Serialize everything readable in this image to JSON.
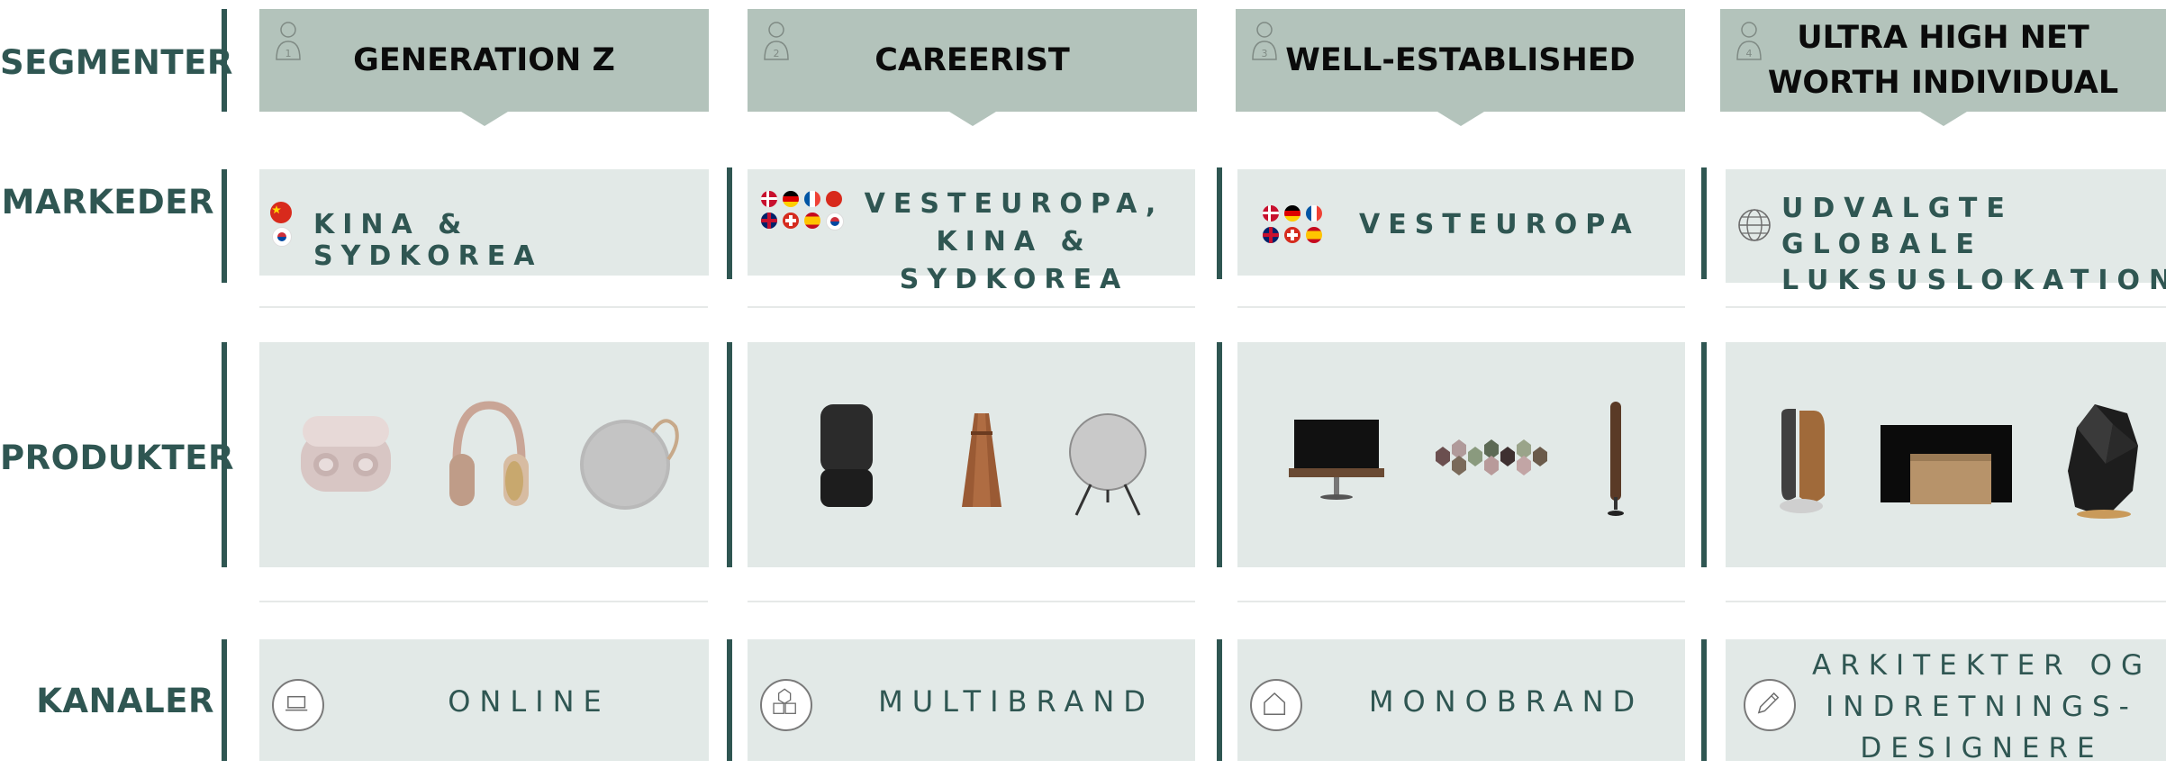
{
  "row_labels": {
    "segments": "SEGMENTER",
    "markets": "MARKEDER",
    "products": "PRODUKTER",
    "channels": "KANALER"
  },
  "segments": [
    {
      "number": "1",
      "title": "GENERATION Z"
    },
    {
      "number": "2",
      "title": "CAREERIST"
    },
    {
      "number": "3",
      "title": "WELL-ESTABLISHED"
    },
    {
      "number": "4",
      "title_line1": "ULTRA HIGH NET",
      "title_line2": "WORTH INDIVIDUAL"
    }
  ],
  "markets": [
    {
      "text": "KINA & SYDKOREA"
    },
    {
      "line1": "VESTEUROPA,",
      "line2": "KINA & SYDKOREA"
    },
    {
      "text": "VESTEUROPA"
    },
    {
      "line1": "UDVALGTE GLOBALE",
      "line2": "LUKSUSLOKATIONER"
    }
  ],
  "channels": [
    {
      "text": "ONLINE",
      "icon": "laptop-icon"
    },
    {
      "text": "MULTIBRAND",
      "icon": "multibrand-icon"
    },
    {
      "text": "MONOBRAND",
      "icon": "house-icon"
    },
    {
      "line1": "ARKITEKTER OG",
      "line2": "INDRETNINGS-",
      "line3": "DESIGNERE",
      "icon": "pencil-icon"
    }
  ],
  "colors": {
    "accent": "#2f5652",
    "header_bg": "#b3c3bb",
    "cell_bg": "#e2e9e7"
  }
}
